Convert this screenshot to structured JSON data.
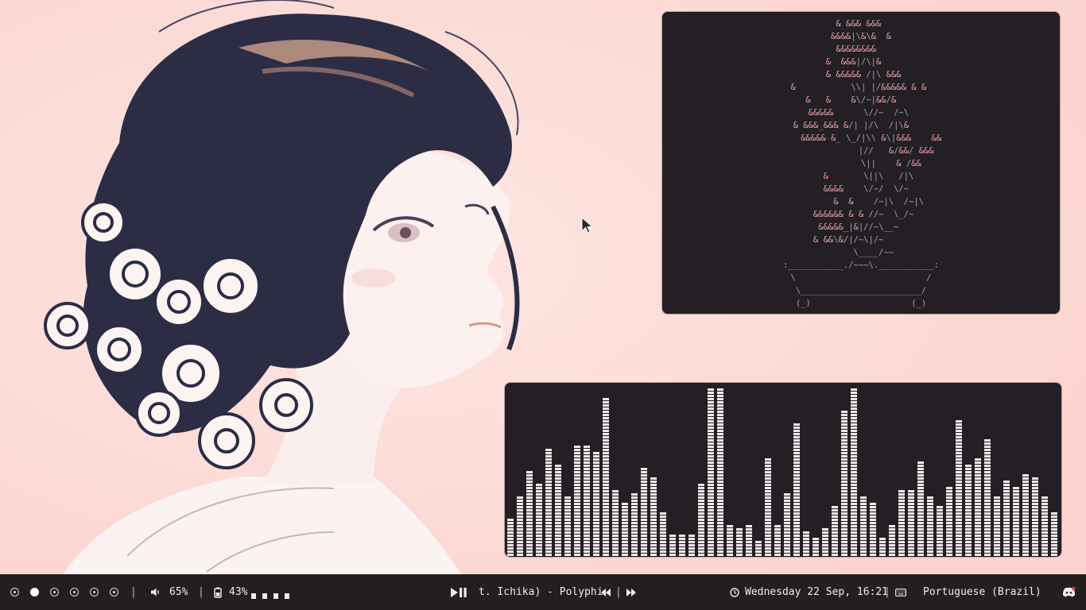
{
  "wallpaper": {
    "subject": "illustrated-girl-with-roses"
  },
  "workspaces": [
    {
      "active": false
    },
    {
      "active": true
    },
    {
      "active": false
    },
    {
      "active": false
    },
    {
      "active": false
    },
    {
      "active": false
    }
  ],
  "status": {
    "volume_icon": "speaker-icon",
    "volume": "65%",
    "battery_icon": "battery-icon",
    "battery": "43%",
    "media": {
      "play_pause_icon": "play-pause-icon",
      "title": "t. Ichika) - Polyphi",
      "prev_icon": "rewind-icon",
      "next_icon": "fast-forward-icon"
    },
    "clock_icon": "clock-icon",
    "datetime": "Wednesday 22 Sep, 16:21",
    "keyboard_icon": "keyboard-icon",
    "keyboard_layout": "Portuguese (Brazil)",
    "tray_icon": "discord-icon"
  },
  "ascii_art": {
    "lines": [
      "         & &&& &&&          ",
      "        &&&&|\\&\\&  &        ",
      "         &&&&&&&&           ",
      "       &  &&&|/\\|&          ",
      "       & &&&&& /|\\ &&&      ",
      "&           \\\\| |/&&&&& & & ",
      "   &   &    &\\/~|&&/&       ",
      "   &&&&&      \\//~  /~\\    ",
      "& &&&_&&& &/| |/\\  /|\\&    ",
      "    &&&&& &_ \\_/|\\\\ &\\|&&&    &&",
      "              |//   &/&&/ &&&",
      "              \\||    & /&&  ",
      "      &       \\||\\   /|\\   ",
      "      &&&&    \\/~/  \\/~    ",
      "        &  &    /~|\\  /~|\\ ",
      "    &&&&&& & & //~  \\_/~   ",
      "     &&&&&_|&|//~\\__~      ",
      "    & &&\\&/|/~\\|/~         ",
      "            \\____/~~       ",
      ":___________./~~~\\.___________:",
      " \\                          / ",
      "  \\________________________/  ",
      "  (_)                    (_)  "
    ]
  },
  "visualizer": {
    "bar_color": "#f4e8ea",
    "levels": [
      0.22,
      0.35,
      0.5,
      0.43,
      0.64,
      0.54,
      0.36,
      0.65,
      0.65,
      0.61,
      0.94,
      0.4,
      0.33,
      0.38,
      0.53,
      0.47,
      0.26,
      0.14,
      0.13,
      0.14,
      0.43,
      0.99,
      0.98,
      0.2,
      0.18,
      0.19,
      0.1,
      0.59,
      0.2,
      0.38,
      0.79,
      0.15,
      0.12,
      0.17,
      0.3,
      0.85,
      0.98,
      0.35,
      0.33,
      0.12,
      0.2,
      0.39,
      0.39,
      0.56,
      0.36,
      0.31,
      0.42,
      0.8,
      0.55,
      0.58,
      0.7,
      0.36,
      0.45,
      0.42,
      0.49,
      0.47,
      0.35,
      0.26
    ]
  },
  "colors": {
    "bar_bg": "#231f1f",
    "terminal_bg": "#231f24",
    "accent_pink": "#e5a3ad",
    "desktop_bg": "#fdd9d5"
  }
}
